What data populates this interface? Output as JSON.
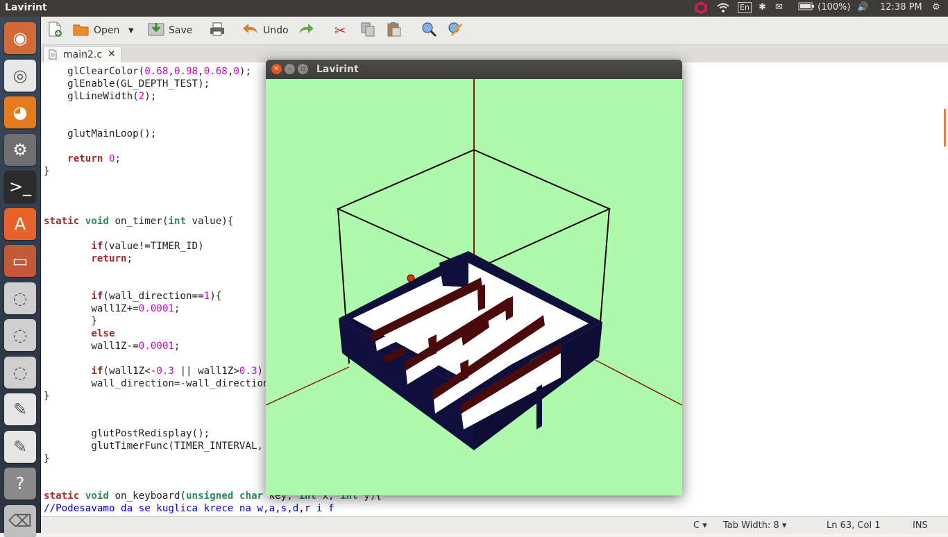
{
  "top_panel": {
    "title": "Lavirint",
    "keyboard": "En",
    "battery": "(100%)",
    "clock": "12:38 PM"
  },
  "launcher": {
    "items": [
      {
        "name": "ubuntu-home-icon",
        "glyph": "◉",
        "bg": "#d36a3a"
      },
      {
        "name": "chrome-icon",
        "glyph": "◎",
        "bg": "#e8e8e8"
      },
      {
        "name": "firefox-icon",
        "glyph": "◕",
        "bg": "#e77a1d"
      },
      {
        "name": "system-settings-icon",
        "glyph": "⚙",
        "bg": "#6f6f6f"
      },
      {
        "name": "terminal-icon",
        "glyph": ">_",
        "bg": "#2b2b2b"
      },
      {
        "name": "software-center-icon",
        "glyph": "A",
        "bg": "#e8632b"
      },
      {
        "name": "file-manager-icon",
        "glyph": "▭",
        "bg": "#c4593a"
      },
      {
        "name": "drive-icon",
        "glyph": "◌",
        "bg": "#cfcfcf"
      },
      {
        "name": "drive-icon",
        "glyph": "◌",
        "bg": "#cfcfcf"
      },
      {
        "name": "drive-icon",
        "glyph": "◌",
        "bg": "#cfcfcf"
      },
      {
        "name": "text-editor-icon",
        "glyph": "✎",
        "bg": "#e6e6e6"
      },
      {
        "name": "text-editor-icon",
        "glyph": "✎",
        "bg": "#e6e6e6"
      },
      {
        "name": "help-icon",
        "glyph": "?",
        "bg": "#8a8a8a"
      },
      {
        "name": "trash-icon",
        "glyph": "⌫",
        "bg": "#bfbfbf"
      }
    ]
  },
  "toolbar": {
    "open_label": "Open",
    "save_label": "Save",
    "undo_label": "Undo"
  },
  "tab": {
    "label": "main2.c",
    "close": "✕"
  },
  "editor": {
    "code_lines": [
      [
        {
          "t": "    glClearColor("
        },
        {
          "t": "0.68",
          "c": "num"
        },
        {
          "t": ","
        },
        {
          "t": "0.98",
          "c": "num"
        },
        {
          "t": ","
        },
        {
          "t": "0.68",
          "c": "num"
        },
        {
          "t": ","
        },
        {
          "t": "0",
          "c": "num"
        },
        {
          "t": ");"
        }
      ],
      [
        {
          "t": "    glEnable(GL_DEPTH_TEST);"
        }
      ],
      [
        {
          "t": "    glLineWidth("
        },
        {
          "t": "2",
          "c": "num"
        },
        {
          "t": ");"
        }
      ],
      [],
      [],
      [
        {
          "t": "    glutMainLoop();"
        }
      ],
      [],
      [
        {
          "t": "    "
        },
        {
          "t": "return",
          "c": "kw"
        },
        {
          "t": " "
        },
        {
          "t": "0",
          "c": "num"
        },
        {
          "t": ";"
        }
      ],
      [
        {
          "t": "}"
        }
      ],
      [],
      [],
      [],
      [
        {
          "t": "static",
          "c": "kw"
        },
        {
          "t": " "
        },
        {
          "t": "void",
          "c": "ty"
        },
        {
          "t": " on_timer("
        },
        {
          "t": "int",
          "c": "ty"
        },
        {
          "t": " value){"
        }
      ],
      [],
      [
        {
          "t": "        "
        },
        {
          "t": "if",
          "c": "kw"
        },
        {
          "t": "(value!=TIMER_ID)"
        }
      ],
      [
        {
          "t": "        "
        },
        {
          "t": "return",
          "c": "kw"
        },
        {
          "t": ";"
        }
      ],
      [],
      [],
      [
        {
          "t": "        "
        },
        {
          "t": "if",
          "c": "kw"
        },
        {
          "t": "(wall_direction=="
        },
        {
          "t": "1",
          "c": "num"
        },
        {
          "t": "){"
        }
      ],
      [
        {
          "t": "        wall1Z+="
        },
        {
          "t": "0.0001",
          "c": "num"
        },
        {
          "t": ";"
        }
      ],
      [
        {
          "t": "        }"
        }
      ],
      [
        {
          "t": "        "
        },
        {
          "t": "else",
          "c": "kw"
        }
      ],
      [
        {
          "t": "        wall1Z-="
        },
        {
          "t": "0.0001",
          "c": "num"
        },
        {
          "t": ";"
        }
      ],
      [],
      [
        {
          "t": "        "
        },
        {
          "t": "if",
          "c": "kw"
        },
        {
          "t": "(wall1Z<-"
        },
        {
          "t": "0.3",
          "c": "num"
        },
        {
          "t": " || wall1Z>"
        },
        {
          "t": "0.3",
          "c": "num"
        },
        {
          "t": ")"
        }
      ],
      [
        {
          "t": "        wall_direction=-wall_direction;"
        }
      ],
      [
        {
          "t": "}"
        }
      ],
      [],
      [],
      [
        {
          "t": "        glutPostRedisplay();"
        }
      ],
      [
        {
          "t": "        glutTimerFunc(TIMER_INTERVAL, on_timer, TIMER_ID);"
        }
      ],
      [
        {
          "t": "}"
        }
      ],
      [],
      [],
      [
        {
          "t": "static",
          "c": "kw"
        },
        {
          "t": " "
        },
        {
          "t": "void",
          "c": "ty"
        },
        {
          "t": " on_keyboard("
        },
        {
          "t": "unsigned",
          "c": "ty"
        },
        {
          "t": " "
        },
        {
          "t": "char",
          "c": "ty"
        },
        {
          "t": " key, "
        },
        {
          "t": "int",
          "c": "ty"
        },
        {
          "t": " x, "
        },
        {
          "t": "int",
          "c": "ty"
        },
        {
          "t": " y){"
        }
      ],
      [
        {
          "t": "//Podesavamo da se kuglica krece na w,a,s,d,r i f",
          "c": "cm"
        }
      ]
    ]
  },
  "statusbar": {
    "language": "C",
    "tab_width": "Tab Width: 8",
    "position": "Ln 63, Col 1",
    "mode": "INS"
  },
  "window": {
    "title": "Lavirint"
  },
  "colors": {
    "canvas_bg": "#adfaad",
    "wall_dark": "#0f0f3c",
    "wall_light": "#ffffff",
    "wall_maroon": "#4a0a0a"
  }
}
